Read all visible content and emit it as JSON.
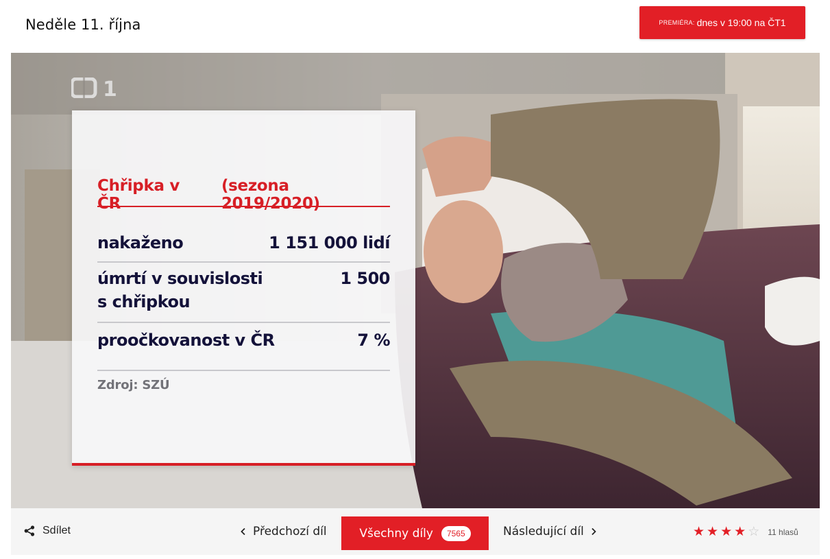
{
  "header": {
    "date": "Neděle 11. října",
    "premiere": {
      "tag": "PREMIÉRA:",
      "when": "dnes v 19:00 na ČT1"
    }
  },
  "hero": {
    "channel_logo": "ČT1",
    "card": {
      "title": "Chřipka v ČR",
      "season": "(sezona 2019/2020)",
      "rows": [
        {
          "label": "nakaženo",
          "value": "1 151 000 lidí"
        },
        {
          "label_line1": "úmrtí v souvislosti",
          "label_line2": "s chřipkou",
          "value": "1 500"
        },
        {
          "label": "proočkovanost v ČR",
          "value": "7 %"
        }
      ],
      "source": "Zdroj: SZÚ"
    },
    "accent_color": "#d71f26",
    "text_color": "#14123a"
  },
  "footer": {
    "share": "Sdílet",
    "prev": "Předchozí díl",
    "all": "Všechny díly",
    "count": "7565",
    "next": "Následující díl",
    "rating": {
      "stars_filled": 4,
      "stars_total": 5,
      "votes": "11 hlasů"
    },
    "brand_color": "#e21f26"
  }
}
